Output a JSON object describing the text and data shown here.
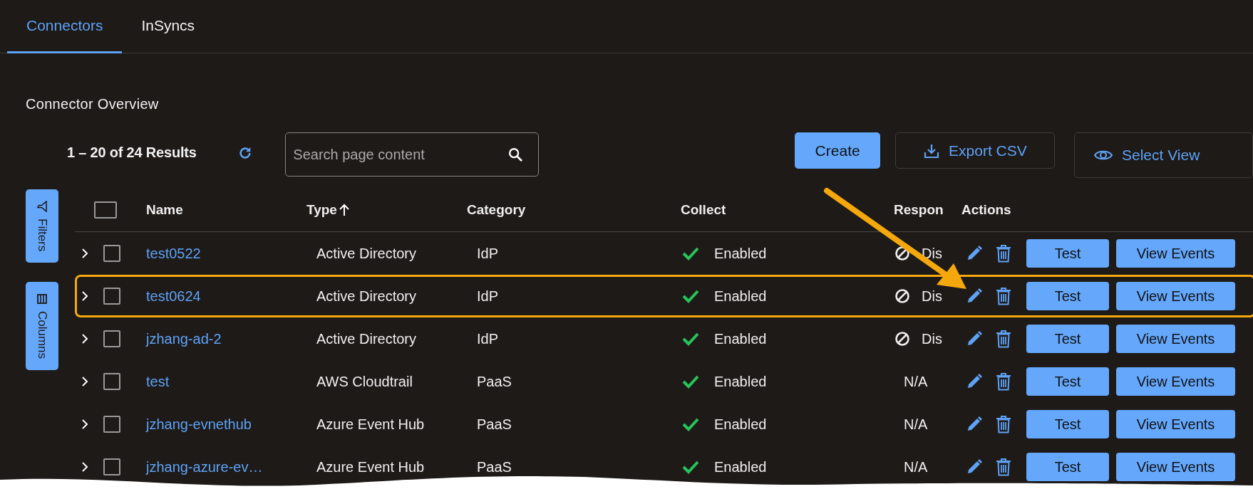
{
  "tabs": [
    {
      "label": "Connectors",
      "selected": true
    },
    {
      "label": "InSyncs",
      "selected": false
    }
  ],
  "section_title": "Connector Overview",
  "toolbar": {
    "results": "1 – 20 of 24 Results",
    "search": {
      "placeholder": "Search page content"
    },
    "buttons": [
      {
        "label": "Create",
        "kind": "primary"
      },
      {
        "label": "Export CSV",
        "kind": "export"
      },
      {
        "label": "Select View",
        "kind": "view"
      }
    ]
  },
  "side_buttons": [
    {
      "label": "Filters",
      "kind": "filter"
    },
    {
      "label": "Columns",
      "kind": "columns"
    }
  ],
  "table": {
    "select_all_checked": false,
    "columns": [
      {
        "label": "Name"
      },
      {
        "label": "Type",
        "sort_ascending": true
      },
      {
        "label": "Category"
      },
      {
        "label": "Collect"
      },
      {
        "label": "Respon"
      },
      {
        "label": "Actions"
      }
    ],
    "rows": [
      {
        "name": "test0522",
        "type": "Active Directory",
        "category": "IdP",
        "collect": {
          "text": "Enabled",
          "ok": true
        },
        "response": {
          "text": "Dis",
          "kind": "disabled"
        },
        "actions": [
          "Test",
          "View Events"
        ],
        "checked": false,
        "highlighted": false
      },
      {
        "name": "test0624",
        "type": "Active Directory",
        "category": "IdP",
        "collect": {
          "text": "Enabled",
          "ok": true
        },
        "response": {
          "text": "Dis",
          "kind": "disabled"
        },
        "actions": [
          "Test",
          "View Events"
        ],
        "checked": false,
        "highlighted": true
      },
      {
        "name": "jzhang-ad-2",
        "type": "Active Directory",
        "category": "IdP",
        "collect": {
          "text": "Enabled",
          "ok": true
        },
        "response": {
          "text": "Dis",
          "kind": "disabled"
        },
        "actions": [
          "Test",
          "View Events"
        ],
        "checked": false,
        "highlighted": false
      },
      {
        "name": "test",
        "type": "AWS Cloudtrail",
        "category": "PaaS",
        "collect": {
          "text": "Enabled",
          "ok": true
        },
        "response": {
          "text": "N/A",
          "kind": "none"
        },
        "actions": [
          "Test",
          "View Events"
        ],
        "checked": false,
        "highlighted": false
      },
      {
        "name": "jzhang-evnethub",
        "type": "Azure Event Hub",
        "category": "PaaS",
        "collect": {
          "text": "Enabled",
          "ok": true
        },
        "response": {
          "text": "N/A",
          "kind": "none"
        },
        "actions": [
          "Test",
          "View Events"
        ],
        "checked": false,
        "highlighted": false
      },
      {
        "name": "jzhang-azure-ev…",
        "type": "Azure Event Hub",
        "category": "PaaS",
        "collect": {
          "text": "Enabled",
          "ok": true
        },
        "response": {
          "text": "N/A",
          "kind": "none"
        },
        "actions": [
          "Test",
          "View Events"
        ],
        "checked": false,
        "highlighted": false
      }
    ]
  }
}
